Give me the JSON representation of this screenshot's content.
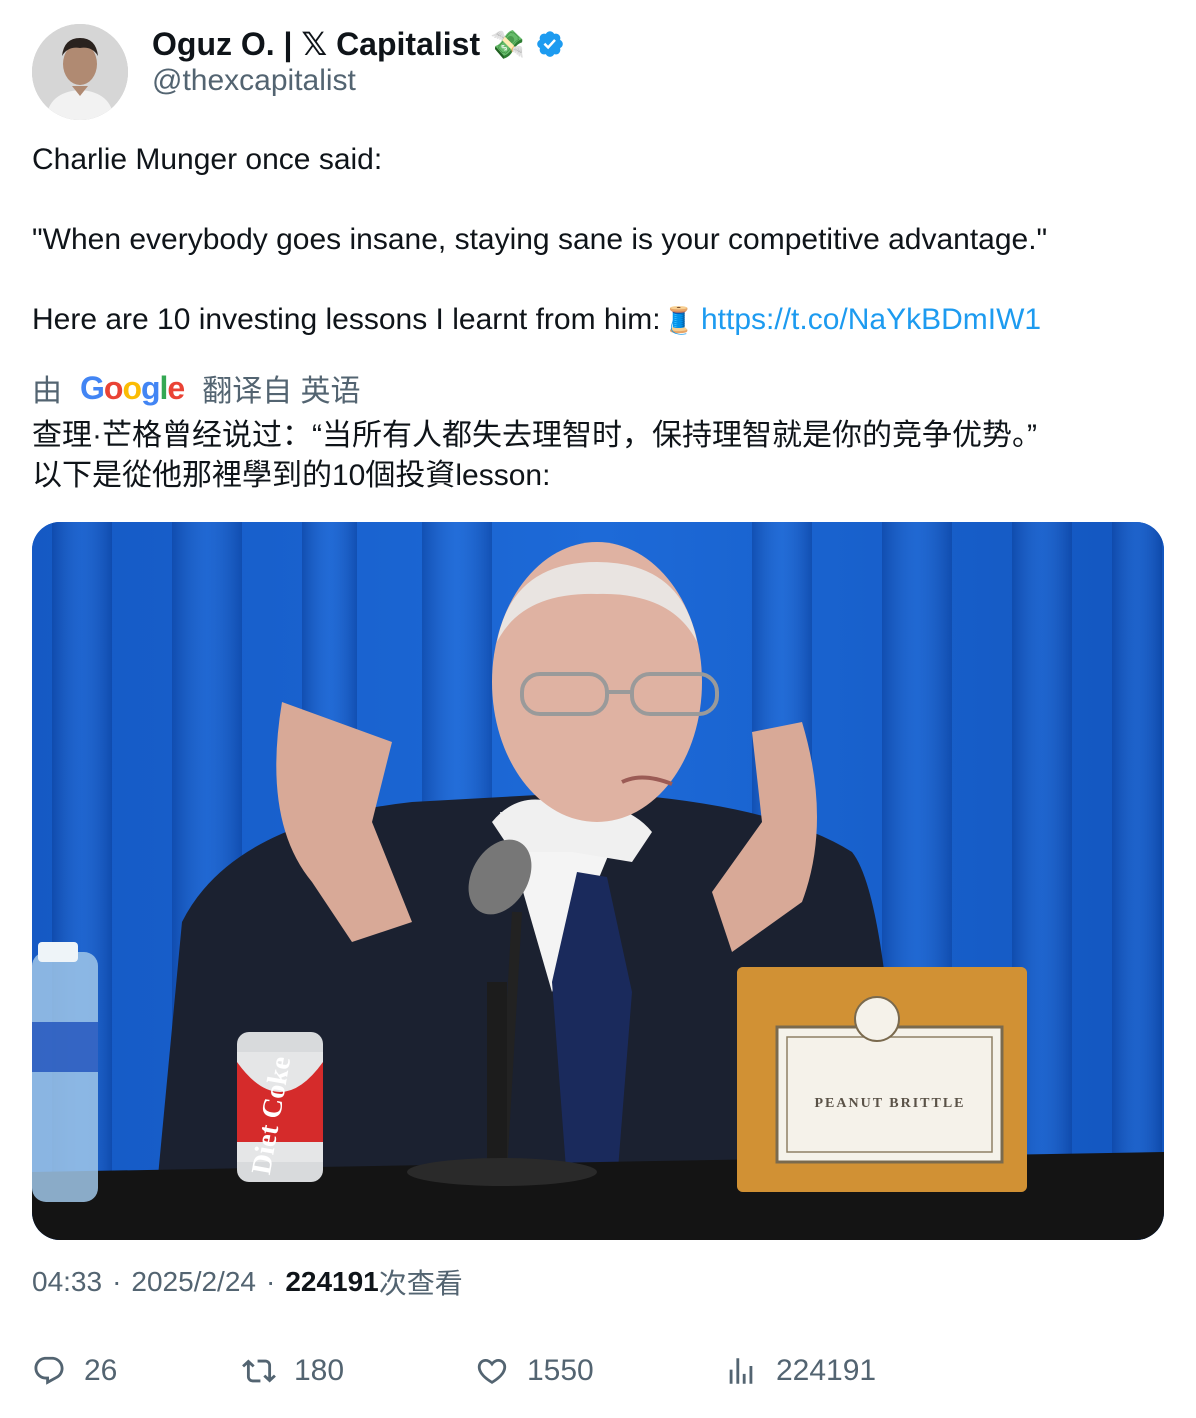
{
  "author": {
    "display_name": "Oguz O. | 𝕏 Capitalist",
    "emoji": "💸",
    "handle": "@thexcapitalist"
  },
  "tweet": {
    "line1": "Charlie Munger once said:",
    "line2": "\"When everybody goes insane, staying sane is your competitive advantage.\"",
    "line3": "Here are 10 investing lessons I learnt from him:",
    "thread_emoji": "🧵",
    "link": "https://t.co/NaYkBDmIW1"
  },
  "translation": {
    "by": "由",
    "google": [
      "G",
      "o",
      "o",
      "g",
      "l",
      "e"
    ],
    "from": "翻译自 英语",
    "line1": "查理·芒格曾经说过：“当所有人都失去理智时，保持理智就是你的竞争优势。”",
    "line2": "以下是從他那裡學到的10個投資lesson:"
  },
  "media": {
    "can_brand": "Diet Coke",
    "box_label": "PEANUT BRITTLE"
  },
  "meta": {
    "time": "04:33",
    "date": "2025/2/24",
    "views_count": "224191",
    "views_suffix": "次查看",
    "separator": "·"
  },
  "actions": {
    "replies": "26",
    "retweets": "180",
    "likes": "1550",
    "views": "224191"
  },
  "colors": {
    "link": "#1d9bf0",
    "secondary_text": "#536471",
    "verified": "#1d9bf0"
  }
}
